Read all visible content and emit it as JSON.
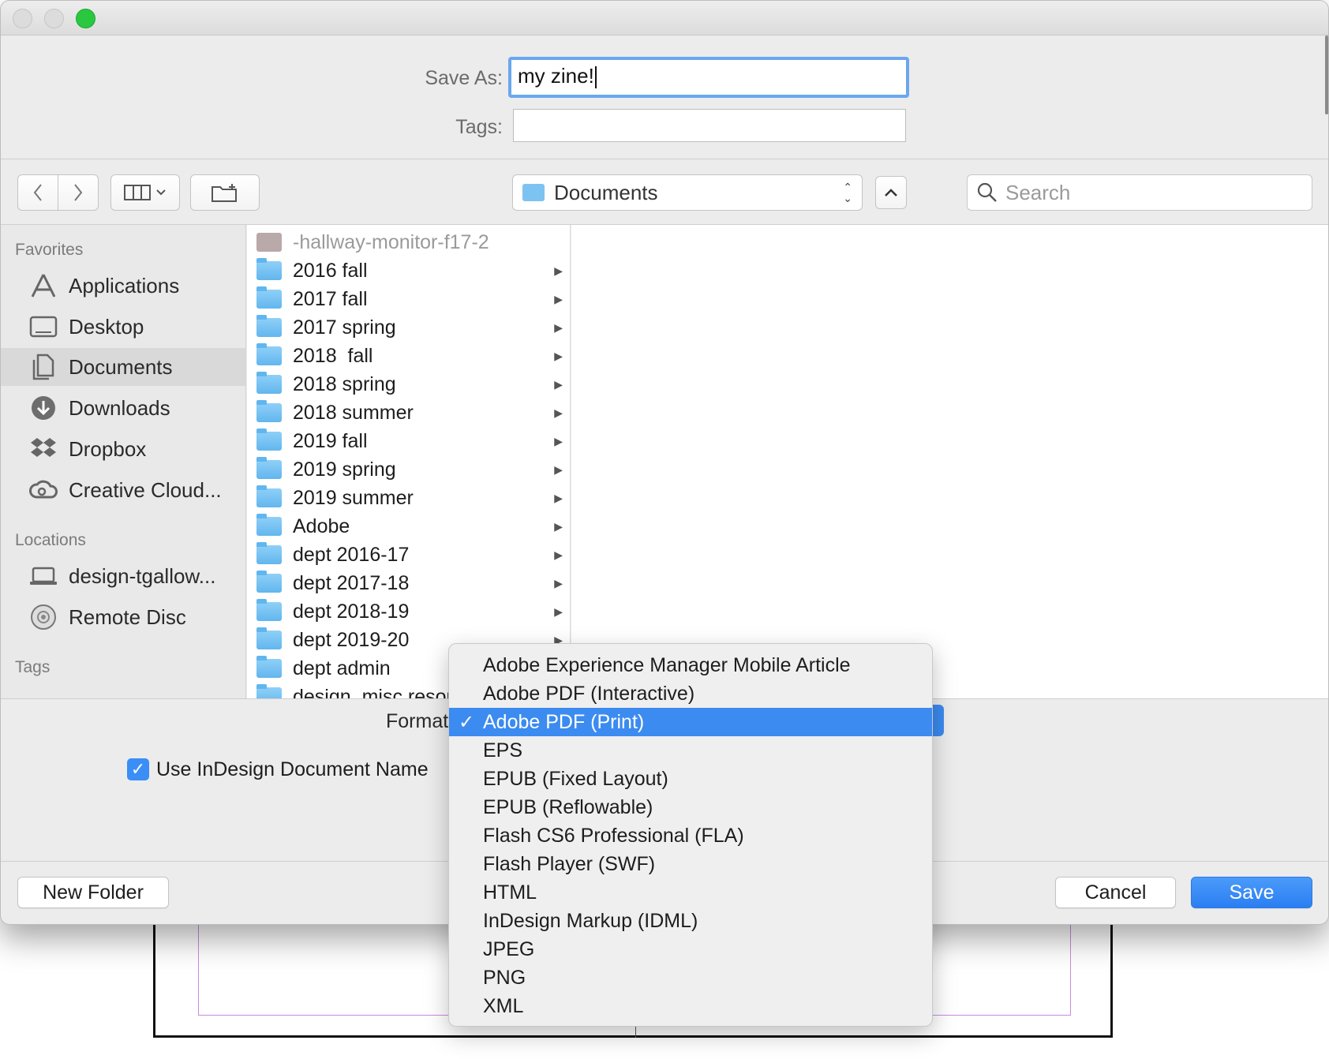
{
  "save_as": {
    "label": "Save As:",
    "value": "my zine!"
  },
  "tags": {
    "label": "Tags:",
    "value": ""
  },
  "toolbar": {
    "location": "Documents",
    "search_placeholder": "Search"
  },
  "sidebar": {
    "favorites_header": "Favorites",
    "favorites": [
      {
        "label": "Applications",
        "icon": "applications-icon"
      },
      {
        "label": "Desktop",
        "icon": "desktop-icon"
      },
      {
        "label": "Documents",
        "icon": "documents-icon",
        "selected": true
      },
      {
        "label": "Downloads",
        "icon": "downloads-icon"
      },
      {
        "label": "Dropbox",
        "icon": "dropbox-icon"
      },
      {
        "label": "Creative Cloud...",
        "icon": "creative-cloud-icon"
      }
    ],
    "locations_header": "Locations",
    "locations": [
      {
        "label": "design-tgallow...",
        "icon": "laptop-icon"
      },
      {
        "label": "Remote Disc",
        "icon": "disc-icon"
      }
    ],
    "tags_header": "Tags"
  },
  "files": [
    {
      "name": "-hallway-monitor-f17-2",
      "type": "file"
    },
    {
      "name": "2016 fall",
      "type": "folder"
    },
    {
      "name": "2017 fall",
      "type": "folder"
    },
    {
      "name": "2017 spring",
      "type": "folder"
    },
    {
      "name": "2018  fall",
      "type": "folder"
    },
    {
      "name": "2018 spring",
      "type": "folder"
    },
    {
      "name": "2018 summer",
      "type": "folder"
    },
    {
      "name": "2019 fall",
      "type": "folder"
    },
    {
      "name": "2019 spring",
      "type": "folder"
    },
    {
      "name": "2019 summer",
      "type": "folder"
    },
    {
      "name": "Adobe",
      "type": "folder"
    },
    {
      "name": "dept 2016-17",
      "type": "folder"
    },
    {
      "name": "dept 2017-18",
      "type": "folder"
    },
    {
      "name": "dept 2018-19",
      "type": "folder"
    },
    {
      "name": "dept 2019-20",
      "type": "folder"
    },
    {
      "name": "dept admin",
      "type": "folder"
    },
    {
      "name": "design_misc resou",
      "type": "folder"
    }
  ],
  "format": {
    "label": "Format",
    "options": [
      "Adobe Experience Manager Mobile Article",
      "Adobe PDF (Interactive)",
      "Adobe PDF (Print)",
      "EPS",
      "EPUB (Fixed Layout)",
      "EPUB (Reflowable)",
      "Flash CS6 Professional (FLA)",
      "Flash Player (SWF)",
      "HTML",
      "InDesign Markup (IDML)",
      "JPEG",
      "PNG",
      "XML"
    ],
    "selected": "Adobe PDF (Print)",
    "check_glyph": "✓"
  },
  "use_doc_name": {
    "label": "Use InDesign Document Name",
    "checked": true
  },
  "buttons": {
    "new_folder": "New Folder",
    "cancel": "Cancel",
    "save": "Save"
  },
  "colors": {
    "accent": "#3b8bf0",
    "folder": "#6cbcf2",
    "window_bg": "#ececec"
  }
}
